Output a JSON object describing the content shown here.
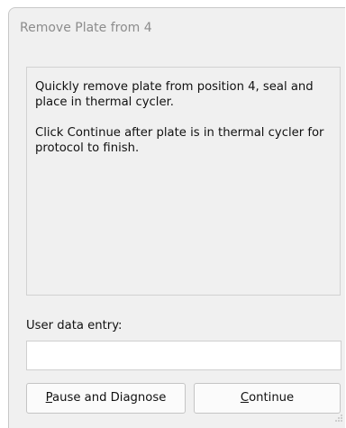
{
  "dialog": {
    "title": "Remove Plate from 4",
    "message": {
      "line1": "Quickly remove plate from position 4, seal and place in thermal cycler.",
      "line2": "Click Continue after plate is in thermal cycler for protocol to finish."
    },
    "entry": {
      "label": "User data entry:",
      "value": ""
    },
    "buttons": {
      "pause": {
        "mnemonic": "P",
        "rest": "ause and Diagnose"
      },
      "continue": {
        "mnemonic": "C",
        "rest": "ontinue"
      }
    }
  }
}
